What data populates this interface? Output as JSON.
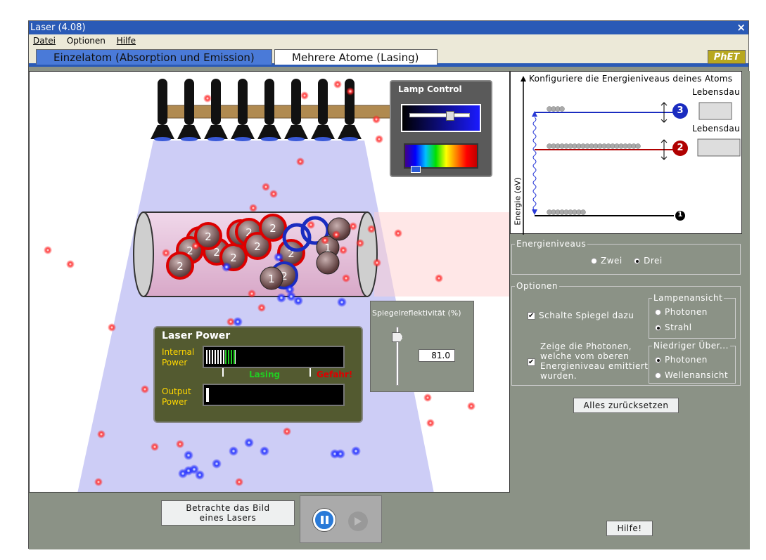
{
  "window": {
    "title": "Laser (4.08)",
    "close_glyph": "×"
  },
  "menu": {
    "file": "Datei",
    "options": "Optionen",
    "help": "Hilfe"
  },
  "tabs": [
    {
      "label": "Einzelatom (Absorption und Emission)",
      "selected": false
    },
    {
      "label": "Mehrere Atome (Lasing)",
      "selected": true
    }
  ],
  "logo": "PhET",
  "lamp_control": {
    "title": "Lamp Control",
    "intensity": 0.62
  },
  "laser_power": {
    "title": "Laser Power",
    "internal_label": "Internal\nPower",
    "output_label": "Output\nPower",
    "lasing_label": "Lasing",
    "danger_label": "Gefahr!",
    "internal_level": 0.22,
    "output_level": 0.02
  },
  "mirror": {
    "title": "Spiegelreflektivität (%)",
    "value": "81.0"
  },
  "energy_diagram": {
    "title": "Konfiguriere die Energieniveaus deines Atoms",
    "lifetime_label": "Lebensdau",
    "y_axis": "Energie (eV)",
    "levels": [
      "3",
      "2",
      "1"
    ]
  },
  "energy_levels": {
    "legend": "Energieniveaus",
    "two": "Zwei",
    "three": "Drei",
    "selected": "Drei"
  },
  "options": {
    "legend": "Optionen",
    "mirrors": "Schalte Spiegel dazu",
    "mirrors_checked": true,
    "show_photons": "Zeige die Photonen, welche vom oberen Energieniveau emittiert wurden.",
    "show_photons_checked": true,
    "lamp_view": {
      "legend": "Lampenansicht",
      "photons": "Photonen",
      "beam": "Strahl",
      "selected": "Strahl"
    },
    "lower_view": {
      "legend": "Niedriger Über...",
      "photons": "Photonen",
      "wave": "Wellenansicht",
      "selected": "Photonen"
    }
  },
  "reset_button": "Alles zurücksetzen",
  "laser_picture_button": "Betrachte das Bild eines Lasers",
  "help_button": "Hilfe!",
  "colors": {
    "title_bar": "#2a5ab6",
    "panel_bg": "#8b9286",
    "beam": "#c8c8f5",
    "level2": "#b00000",
    "level3": "#1a2cc0"
  }
}
